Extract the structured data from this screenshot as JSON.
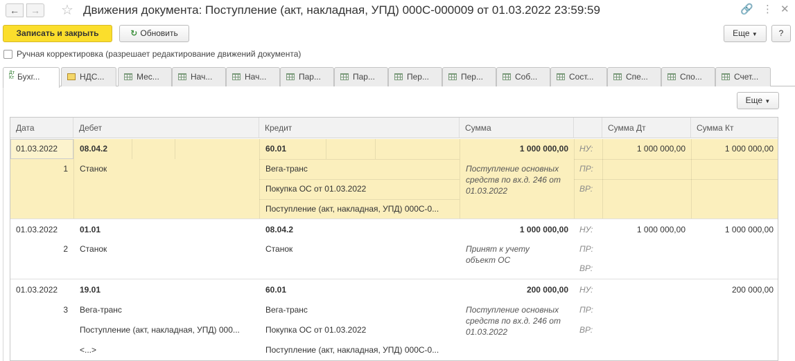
{
  "window": {
    "title": "Движения документа: Поступление (акт, накладная, УПД) 000С-000009 от 01.03.2022 23:59:59"
  },
  "toolbar": {
    "save_close_label": "Записать и закрыть",
    "refresh_label": "Обновить",
    "more_label": "Еще",
    "help_label": "?"
  },
  "manual_correction": {
    "label": "Ручная корректировка (разрешает редактирование движений документа)",
    "checked": false
  },
  "tabs": [
    {
      "label": "Бухг...",
      "icon": "dt-kt-icon",
      "active": true
    },
    {
      "label": "НДС...",
      "icon": "document-icon"
    },
    {
      "label": "Мес...",
      "icon": "table-icon"
    },
    {
      "label": "Нач...",
      "icon": "table-icon"
    },
    {
      "label": "Нач...",
      "icon": "table-icon"
    },
    {
      "label": "Пар...",
      "icon": "table-icon"
    },
    {
      "label": "Пар...",
      "icon": "table-icon"
    },
    {
      "label": "Пер...",
      "icon": "table-icon"
    },
    {
      "label": "Пер...",
      "icon": "table-icon"
    },
    {
      "label": "Соб...",
      "icon": "table-icon"
    },
    {
      "label": "Сост...",
      "icon": "table-icon"
    },
    {
      "label": "Спе...",
      "icon": "table-icon"
    },
    {
      "label": "Спо...",
      "icon": "table-icon"
    },
    {
      "label": "Счет...",
      "icon": "table-icon"
    }
  ],
  "grid_more_label": "Еще",
  "columns": [
    "Дата",
    "Дебет",
    "Кредит",
    "Сумма",
    "",
    "Сумма Дт",
    "Сумма Кт"
  ],
  "rows": [
    {
      "date": "01.03.2022",
      "num": "1",
      "debit_account": "08.04.2",
      "debit_subconto": [
        "Станок"
      ],
      "credit_account": "60.01",
      "credit_subconto": [
        "Вега-транс",
        "Покупка ОС от 01.03.2022",
        "Поступление (акт, накладная, УПД) 000С-0..."
      ],
      "amount": "1 000 000,00",
      "content": "Поступление основных средств по вх.д. 246 от 01.03.2022",
      "labels": [
        "НУ:",
        "ПР:",
        "ВР:"
      ],
      "dt_nu": "1 000 000,00",
      "kt_nu": "1 000 000,00"
    },
    {
      "date": "01.03.2022",
      "num": "2",
      "debit_account": "01.01",
      "debit_subconto": [
        "Станок"
      ],
      "credit_account": "08.04.2",
      "credit_subconto": [
        "Станок"
      ],
      "amount": "1 000 000,00",
      "content": "Принят к учету объект ОС",
      "labels": [
        "НУ:",
        "ПР:",
        "ВР:"
      ],
      "dt_nu": "1 000 000,00",
      "kt_nu": "1 000 000,00"
    },
    {
      "date": "01.03.2022",
      "num": "3",
      "debit_account": "19.01",
      "debit_subconto": [
        "Вега-транс",
        "Поступление (акт, накладная, УПД) 000...",
        "<...>"
      ],
      "credit_account": "60.01",
      "credit_subconto": [
        "Вега-транс",
        "Покупка ОС от 01.03.2022",
        "Поступление (акт, накладная, УПД) 000С-0..."
      ],
      "amount": "200 000,00",
      "content": "Поступление основных средств по вх.д. 246 от 01.03.2022",
      "labels": [
        "НУ:",
        "ПР:",
        "ВР:"
      ],
      "dt_nu": "",
      "kt_nu": "200 000,00"
    }
  ]
}
